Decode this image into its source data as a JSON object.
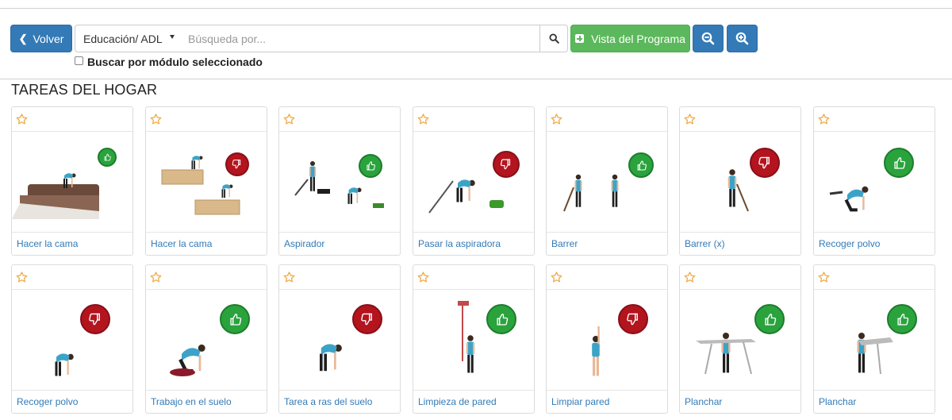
{
  "toolbar": {
    "back_label": "Volver",
    "category_value": "Educación/ ADL",
    "search_placeholder": "Búsqueda por...",
    "program_label": "Vista del Programa",
    "module_checkbox_label": "Buscar por módulo seleccionado"
  },
  "section_title": "TAREAS DEL HOGAR",
  "colors": {
    "primary": "#337ab7",
    "success": "#5cb85c",
    "thumb_up_badge": "#2aa33d",
    "thumb_down_badge": "#b3141e",
    "star": "#f0ad4e"
  },
  "exercises": [
    {
      "label": "Hacer la cama",
      "rating": "thumbs-up",
      "favorite": false
    },
    {
      "label": "Hacer la cama",
      "rating": "thumbs-down",
      "favorite": false
    },
    {
      "label": "Aspirador",
      "rating": "thumbs-up",
      "favorite": false
    },
    {
      "label": "Pasar la aspiradora",
      "rating": "thumbs-down",
      "favorite": false
    },
    {
      "label": "Barrer",
      "rating": "thumbs-up",
      "favorite": false
    },
    {
      "label": "Barrer (x)",
      "rating": "thumbs-down",
      "favorite": false
    },
    {
      "label": "Recoger polvo",
      "rating": "thumbs-up",
      "favorite": false
    },
    {
      "label": "Recoger polvo",
      "rating": "thumbs-down",
      "favorite": false
    },
    {
      "label": "Trabajo en el suelo",
      "rating": "thumbs-up",
      "favorite": false
    },
    {
      "label": "Tarea a ras del suelo",
      "rating": "thumbs-down",
      "favorite": false
    },
    {
      "label": "Limpieza de pared",
      "rating": "thumbs-up",
      "favorite": false
    },
    {
      "label": "Limpiar pared",
      "rating": "thumbs-down",
      "favorite": false
    },
    {
      "label": "Planchar",
      "rating": "thumbs-up",
      "favorite": false
    },
    {
      "label": "Planchar",
      "rating": "thumbs-up",
      "favorite": false
    }
  ]
}
